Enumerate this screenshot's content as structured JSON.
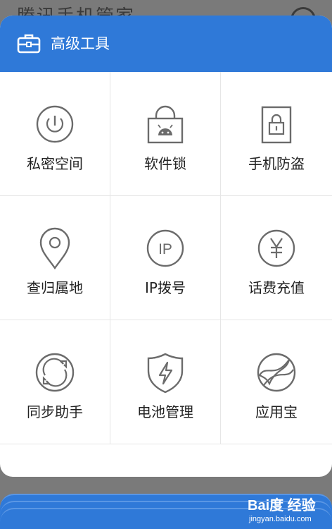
{
  "background": {
    "title": "腾讯手机管家",
    "watermark": {
      "logo": "Bai度 经验",
      "url": "jingyan.baidu.com"
    }
  },
  "dialog": {
    "title": "高级工具",
    "tools": [
      {
        "label": "私密空间",
        "icon": "dial-icon"
      },
      {
        "label": "软件锁",
        "icon": "android-lock-icon"
      },
      {
        "label": "手机防盗",
        "icon": "phone-lock-icon"
      },
      {
        "label": "查归属地",
        "icon": "location-pin-icon"
      },
      {
        "label": "IP拨号",
        "icon": "ip-icon"
      },
      {
        "label": "话费充值",
        "icon": "yuan-icon"
      },
      {
        "label": "同步助手",
        "icon": "sync-icon"
      },
      {
        "label": "电池管理",
        "icon": "battery-shield-icon"
      },
      {
        "label": "应用宝",
        "icon": "app-store-icon"
      }
    ]
  },
  "colors": {
    "accent": "#2f79d8",
    "icon_stroke": "#6b6b6b",
    "overlay": "#7a7a7a"
  }
}
